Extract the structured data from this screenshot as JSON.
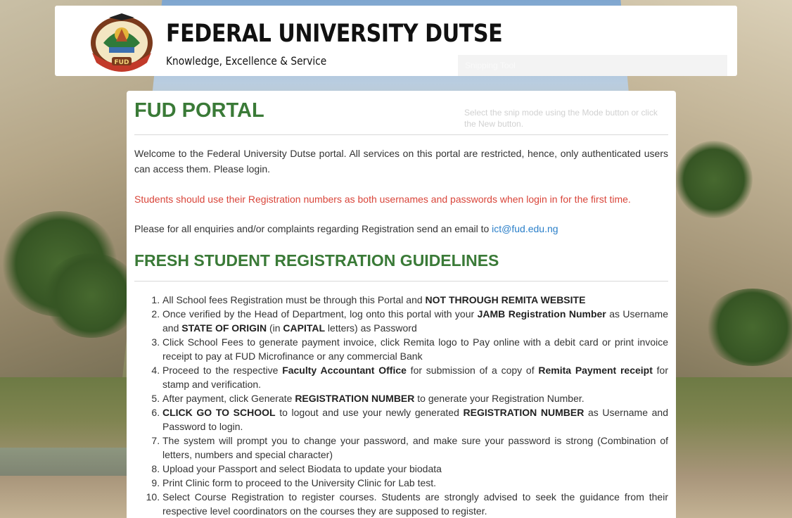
{
  "header": {
    "title": "FEDERAL UNIVERSITY DUTSE",
    "motto": "Knowledge, Excellence & Service",
    "logo_text": "FUD",
    "logo_ring_text": "FEDERAL UNIVERSITY DUTSE"
  },
  "ghost_overlay": {
    "title": "Snipping Tool",
    "hint": "Select the snip mode using the Mode button or click the New button."
  },
  "portal": {
    "title": "FUD PORTAL",
    "welcome": "Welcome to the Federal University Dutse portal. All services on this portal are restricted, hence, only authenticated users can access them. Please login.",
    "notice": "Students should use their Registration numbers as both usernames and passwords when login in for the first time.",
    "enquiry_prefix": "Please for all enquiries and/or complaints regarding Registration send an email to ",
    "enquiry_email": "ict@fud.edu.ng"
  },
  "guidelines": {
    "title": "FRESH STUDENT REGISTRATION GUIDELINES",
    "steps": [
      {
        "parts": [
          {
            "t": "All School fees Registration must be through this Portal and "
          },
          {
            "t": "NOT THROUGH REMITA WEBSITE",
            "b": true
          }
        ]
      },
      {
        "parts": [
          {
            "t": "Once verified by the Head of Department, log onto this portal with your "
          },
          {
            "t": "JAMB Registration Number",
            "b": true
          },
          {
            "t": " as Username and "
          },
          {
            "t": "STATE OF ORIGIN",
            "b": true
          },
          {
            "t": " (in "
          },
          {
            "t": "CAPITAL",
            "b": true
          },
          {
            "t": " letters) as Password"
          }
        ]
      },
      {
        "parts": [
          {
            "t": "Click School Fees to generate payment invoice, click Remita logo to Pay online with a debit card or print invoice receipt to pay at FUD Microfinance or any commercial Bank"
          }
        ]
      },
      {
        "parts": [
          {
            "t": "Proceed to the respective "
          },
          {
            "t": "Faculty Accountant Office",
            "b": true
          },
          {
            "t": " for submission of a copy of "
          },
          {
            "t": "Remita Payment receipt",
            "b": true
          },
          {
            "t": " for stamp and verification."
          }
        ]
      },
      {
        "parts": [
          {
            "t": "After payment, click Generate "
          },
          {
            "t": "REGISTRATION NUMBER",
            "b": true
          },
          {
            "t": " to generate your Registration Number."
          }
        ]
      },
      {
        "parts": [
          {
            "t": "CLICK GO TO SCHOOL",
            "b": true
          },
          {
            "t": " to logout and use your newly generated "
          },
          {
            "t": "REGISTRATION NUMBER",
            "b": true
          },
          {
            "t": " as Username and Password to login."
          }
        ]
      },
      {
        "parts": [
          {
            "t": "The system will prompt you to change your password, and make sure your password is strong (Combination of letters, numbers and special character)"
          }
        ]
      },
      {
        "parts": [
          {
            "t": "Upload your Passport and select Biodata to update your biodata"
          }
        ]
      },
      {
        "parts": [
          {
            "t": "Print Clinic form to proceed to the University Clinic for Lab test."
          }
        ]
      },
      {
        "parts": [
          {
            "t": "Select Course Registration to register courses. Students are strongly advised to seek the guidance from their respective level coordinators on the courses they are supposed to register."
          }
        ]
      }
    ]
  },
  "colors": {
    "heading_green": "#3a7a37",
    "notice_red": "#d9453a",
    "link_blue": "#2a7fc9"
  }
}
